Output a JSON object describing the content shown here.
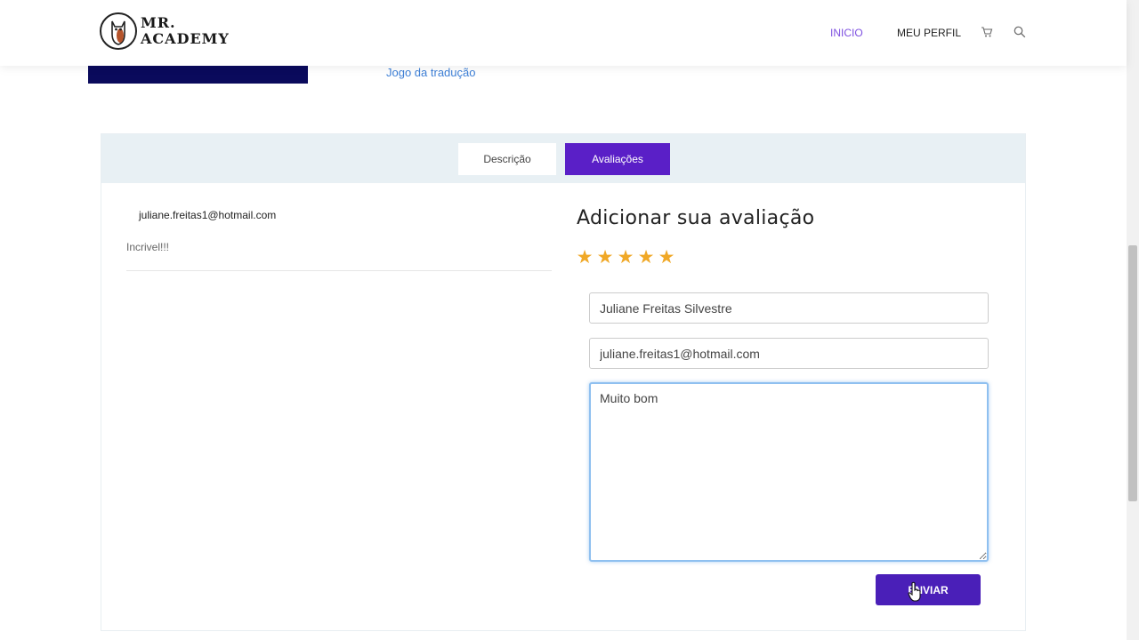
{
  "header": {
    "logo_line1": "MR.",
    "logo_line2": "ACADEMY",
    "nav": {
      "inicio": "INICIO",
      "meu_perfil": "MEU PERFIL"
    },
    "icons": {
      "cart": "cart-icon",
      "search": "search-icon"
    },
    "active_color": "#7d4fe0"
  },
  "banner": {
    "link_text": "Jogo da tradução"
  },
  "tabs": [
    {
      "label": "Descrição",
      "active": false
    },
    {
      "label": "Avaliações",
      "active": true
    }
  ],
  "review": {
    "email": "juliane.freitas1@hotmail.com",
    "text": "Incrivel!!!"
  },
  "form": {
    "title": "Adicionar sua avaliação",
    "rating": 5,
    "star_glyph": "★",
    "name_value": "Juliane Freitas Silvestre",
    "email_value": "juliane.freitas1@hotmail.com",
    "message_value": "Muito bom",
    "submit_label": "ENVIAR"
  },
  "colors": {
    "accent": "#5a1fc7",
    "star": "#f0a826",
    "link": "#3d7fd6"
  }
}
